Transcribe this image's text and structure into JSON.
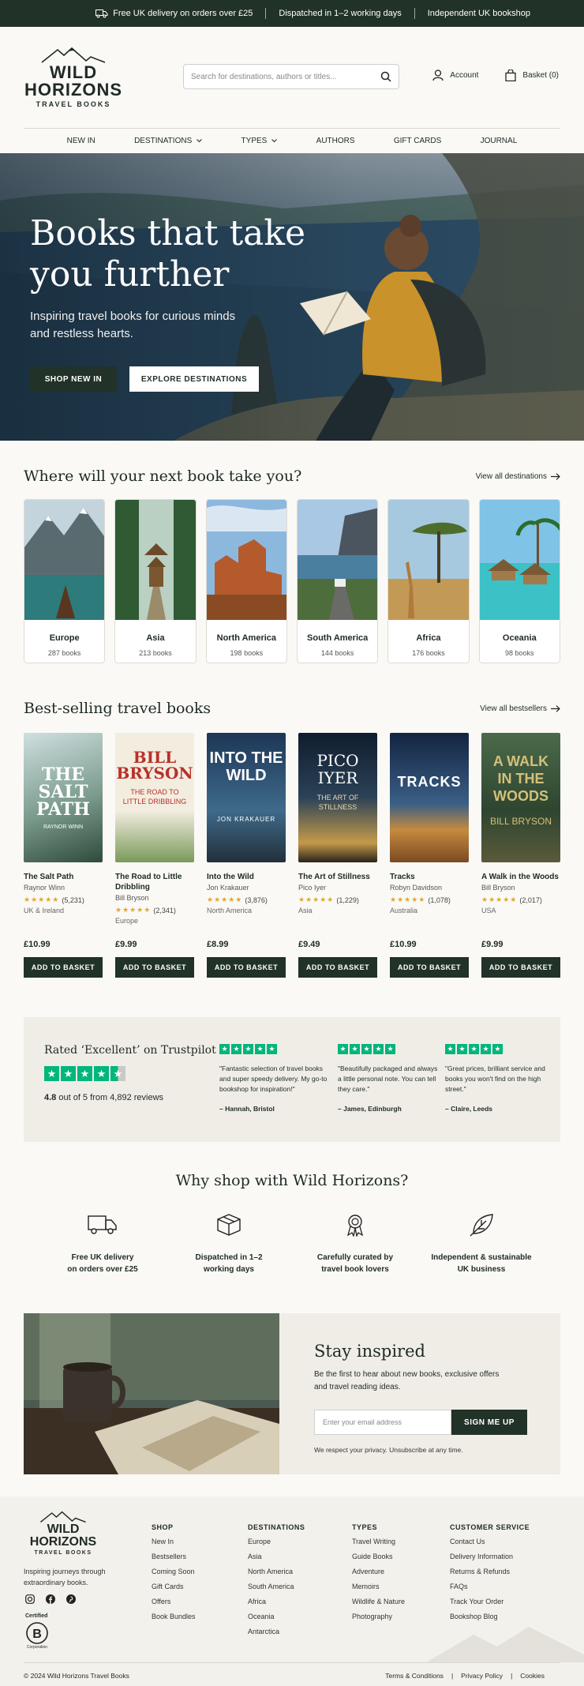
{
  "topbar": {
    "items": [
      "Free UK delivery on orders over £25",
      "Dispatched in 1–2 working days",
      "Independent UK bookshop"
    ]
  },
  "brand": {
    "line1": "WILD",
    "line2": "HORIZONS",
    "line3": "TRAVEL BOOKS"
  },
  "search": {
    "placeholder": "Search for destinations, authors or titles..."
  },
  "account": {
    "label": "Account"
  },
  "basket": {
    "label": "Basket (0)"
  },
  "nav": {
    "items": [
      "NEW IN",
      "DESTINATIONS",
      "TYPES",
      "AUTHORS",
      "GIFT CARDS",
      "JOURNAL"
    ]
  },
  "hero": {
    "title_line1": "Books that take",
    "title_line2": "you further",
    "subtitle_line1": "Inspiring travel books for curious minds",
    "subtitle_line2": "and restless hearts.",
    "btn_primary": "SHOP NEW IN",
    "btn_secondary": "EXPLORE DESTINATIONS"
  },
  "destinations": {
    "heading": "Where will your next book take you?",
    "link": "View all destinations",
    "items": [
      {
        "name": "Europe",
        "count": "287 books"
      },
      {
        "name": "Asia",
        "count": "213 books"
      },
      {
        "name": "North America",
        "count": "198 books"
      },
      {
        "name": "South America",
        "count": "144 books"
      },
      {
        "name": "Africa",
        "count": "176 books"
      },
      {
        "name": "Oceania",
        "count": "98 books"
      }
    ]
  },
  "bestsellers": {
    "heading": "Best-selling travel books",
    "link": "View all bestsellers",
    "button": "ADD TO BASKET",
    "items": [
      {
        "title": "The Salt Path",
        "author": "Raynor Winn",
        "reviews": "(5,231)",
        "region": "UK & Ireland",
        "price": "£10.99",
        "cover_text": "THE SALT PATH",
        "cover_author": "RAYNOR WINN"
      },
      {
        "title": "The Road to Little Dribbling",
        "author": "Bill Bryson",
        "reviews": "(2,341)",
        "region": "Europe",
        "price": "£9.99",
        "cover_text": "BILL BRYSON",
        "cover_sub": "THE ROAD TO LITTLE DRIBBLING"
      },
      {
        "title": "Into the Wild",
        "author": "Jon Krakauer",
        "reviews": "(3,876)",
        "region": "North America",
        "price": "£8.99",
        "cover_text": "INTO THE WILD",
        "cover_author": "JON KRAKAUER"
      },
      {
        "title": "The Art of Stillness",
        "author": "Pico Iyer",
        "reviews": "(1,229)",
        "region": "Asia",
        "price": "£9.49",
        "cover_text": "PICO IYER",
        "cover_sub": "THE ART OF STILLNESS"
      },
      {
        "title": "Tracks",
        "author": "Robyn Davidson",
        "reviews": "(1,078)",
        "region": "Australia",
        "price": "£10.99",
        "cover_text": "TRACKS"
      },
      {
        "title": "A Walk in the Woods",
        "author": "Bill Bryson",
        "reviews": "(2,017)",
        "region": "USA",
        "price": "£9.99",
        "cover_text": "A WALK IN THE WOODS",
        "cover_author": "BILL BRYSON"
      }
    ]
  },
  "trustpilot": {
    "heading": "Rated ‘Excellent’ on Trustpilot",
    "score": "4.8",
    "summary": "out of 5 from 4,892 reviews",
    "reviews": [
      {
        "text": "\"Fantastic selection of travel books and super speedy delivery. My go-to bookshop for inspiration!\"",
        "author": "– Hannah, Bristol"
      },
      {
        "text": "\"Beautifully packaged and always a little personal note. You can tell they care.\"",
        "author": "– James, Edinburgh"
      },
      {
        "text": "\"Great prices, brilliant service and books you won't find on the high street.\"",
        "author": "– Claire, Leeds"
      }
    ],
    "color": "#00b67a"
  },
  "why": {
    "heading": "Why shop with Wild Horizons?",
    "features": [
      {
        "line1": "Free UK delivery",
        "line2": "on orders over £25",
        "icon": "truck-icon"
      },
      {
        "line1": "Dispatched in 1–2",
        "line2": "working days",
        "icon": "box-icon"
      },
      {
        "line1": "Carefully curated by",
        "line2": "travel book lovers",
        "icon": "award-icon"
      },
      {
        "line1": "Independent & sustainable",
        "line2": "UK business",
        "icon": "leaf-icon"
      }
    ]
  },
  "newsletter": {
    "heading": "Stay inspired",
    "text_line1": "Be the first to hear about new books, exclusive offers",
    "text_line2": "and travel reading ideas.",
    "placeholder": "Enter your email address",
    "button": "SIGN ME UP",
    "privacy": "We respect your privacy. Unsubscribe at any time."
  },
  "footer": {
    "tagline_line1": "Inspiring journeys through",
    "tagline_line2": "extraordinary books.",
    "certified": "Certified",
    "corporation": "Corporation",
    "columns": [
      {
        "title": "SHOP",
        "links": [
          "New In",
          "Bestsellers",
          "Coming Soon",
          "Gift Cards",
          "Offers",
          "Book Bundles"
        ]
      },
      {
        "title": "DESTINATIONS",
        "links": [
          "Europe",
          "Asia",
          "North America",
          "South America",
          "Africa",
          "Oceania",
          "Antarctica"
        ]
      },
      {
        "title": "TYPES",
        "links": [
          "Travel Writing",
          "Guide Books",
          "Adventure",
          "Memoirs",
          "Wildlife & Nature",
          "Photography"
        ]
      },
      {
        "title": "CUSTOMER SERVICE",
        "links": [
          "Contact Us",
          "Delivery Information",
          "Returns & Refunds",
          "FAQs",
          "Track Your Order",
          "Bookshop Blog"
        ]
      }
    ],
    "copyright": "© 2024 Wild Horizons Travel Books",
    "legal": [
      "Terms & Conditions",
      "Privacy Policy",
      "Cookies"
    ]
  },
  "colors": {
    "brand_dark": "#213228",
    "star": "#e5a823"
  }
}
